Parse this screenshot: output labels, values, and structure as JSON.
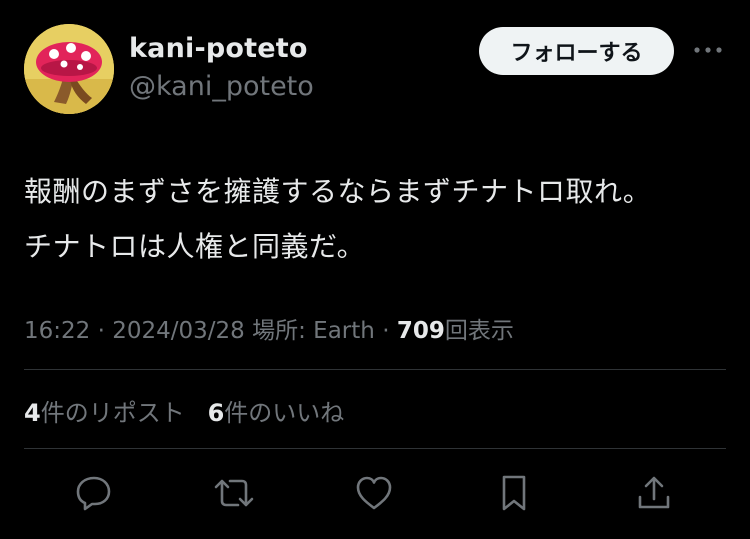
{
  "user": {
    "display_name": "kani-poteto",
    "handle": "@kani_poteto",
    "follow_label": "フォローする"
  },
  "tweet": {
    "lines": [
      "報酬のまずさを擁護するならまずチナトロ取れ。",
      "チナトロは人権と同義だ。"
    ]
  },
  "meta": {
    "time": "16:22",
    "separator": "·",
    "date": "2024/03/28",
    "location": "場所: Earth",
    "views_count": "709",
    "views_label": "回表示"
  },
  "stats": {
    "reposts_count": "4",
    "reposts_label": "件のリポスト",
    "likes_count": "6",
    "likes_label": "件のいいね"
  },
  "actions": [
    "reply-icon",
    "repost-icon",
    "like-icon",
    "bookmark-icon",
    "share-icon"
  ],
  "colors": {
    "background": "#000000",
    "primary_text": "#e7e9ea",
    "secondary_text": "#71767b",
    "divider": "#2f3336",
    "follow_button_bg": "#eff3f4",
    "follow_button_text": "#0f1419"
  }
}
